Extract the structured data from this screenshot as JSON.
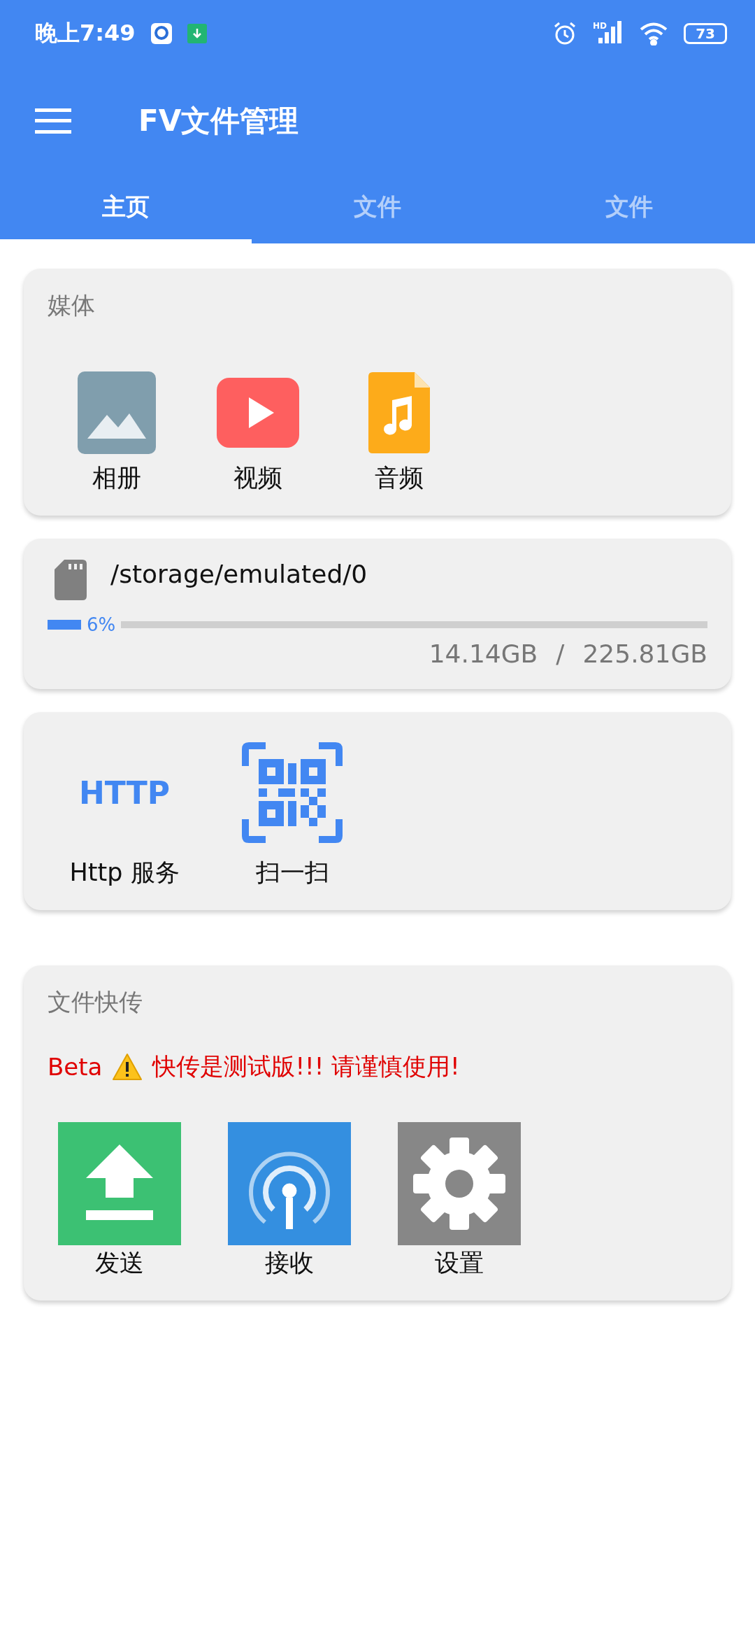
{
  "status_bar": {
    "time": "晚上7:49",
    "network": "HD",
    "battery": "73"
  },
  "app_bar": {
    "title": "FV文件管理"
  },
  "tabs": [
    {
      "label": "主页",
      "selected": true
    },
    {
      "label": "文件",
      "selected": false
    },
    {
      "label": "文件",
      "selected": false
    }
  ],
  "media_card": {
    "title": "媒体",
    "items": [
      {
        "kind": "photo",
        "label": "相册"
      },
      {
        "kind": "video",
        "label": "视频"
      },
      {
        "kind": "audio",
        "label": "音频"
      }
    ]
  },
  "storage_card": {
    "path": "/storage/emulated/0",
    "level": 0.06,
    "percent": "6%",
    "used": "14.14GB",
    "separator": "/",
    "total": "225.81GB"
  },
  "tools_card": {
    "items": [
      {
        "kind": "http",
        "icon_text": "HTTP",
        "label": "Http 服务"
      },
      {
        "kind": "scan",
        "label": "扫一扫"
      }
    ]
  },
  "transfer_card": {
    "title": "文件快传",
    "beta": "Beta",
    "warning": "快传是测试版!!! 请谨慎使用!",
    "items": [
      {
        "kind": "send",
        "label": "发送"
      },
      {
        "kind": "receive",
        "label": "接收"
      },
      {
        "kind": "settings",
        "label": "设置"
      }
    ]
  }
}
